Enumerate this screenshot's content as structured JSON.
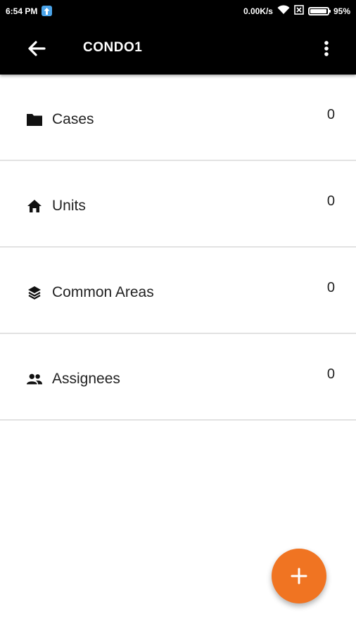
{
  "status_bar": {
    "time": "6:54 PM",
    "network_speed": "0.00K/s",
    "battery": "95%",
    "battery_level": 0.95,
    "icons": [
      "upload-notification-icon",
      "wifi-icon",
      "sim-icon",
      "battery-icon"
    ]
  },
  "app_bar": {
    "title": "CONDO1",
    "back_icon": "arrow-left-icon",
    "menu_icon": "more-vert-icon"
  },
  "rows": [
    {
      "label": "Cases",
      "count": "0",
      "icon": "folder-icon"
    },
    {
      "label": "Units",
      "count": "0",
      "icon": "home-icon"
    },
    {
      "label": "Common Areas",
      "count": "0",
      "icon": "layers-icon"
    },
    {
      "label": "Assignees",
      "count": "0",
      "icon": "people-icon"
    }
  ],
  "fab": {
    "icon": "plus-icon"
  },
  "colors": {
    "app_bar": "#000000",
    "fab": "#f07422",
    "divider": "#e2e2e2",
    "text": "#222222"
  }
}
